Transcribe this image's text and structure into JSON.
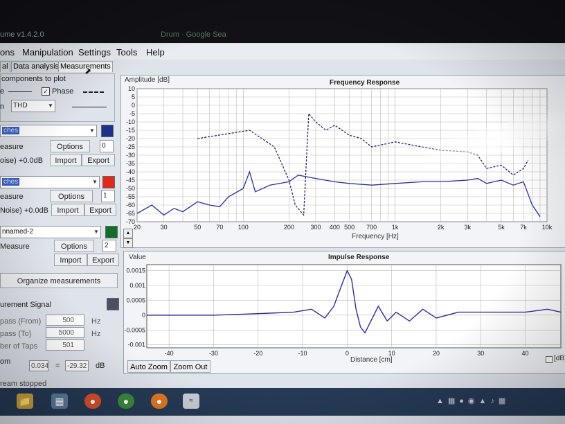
{
  "window": {
    "title": "ume v1.4.2.0",
    "title2": "Drum · Google Sea"
  },
  "menu": [
    "ons",
    "Manipulation",
    "Settings",
    "Tools",
    "Help"
  ],
  "tabs": [
    "al",
    "Data analysis",
    "Measurements"
  ],
  "panel": {
    "components_label": "components to plot",
    "line_label": "e",
    "phase_label": "Phase",
    "thd_prefix": "n",
    "thd_value": "THD",
    "measurements": [
      {
        "name": "ches",
        "color": "#1f2f8c",
        "measure_label": "easure",
        "options_label": "Options",
        "index": "0",
        "noise": "oise) +0.0dB",
        "import_label": "Import",
        "export_label": "Export"
      },
      {
        "name": "ches",
        "color": "#e02a1a",
        "measure_label": "easure",
        "options_label": "Options",
        "index": "1",
        "noise": "Noise) +0.0dB",
        "import_label": "Import",
        "export_label": "Export"
      },
      {
        "name": "nnamed-2",
        "color": "#0f6e2a",
        "measure_label": "Measure",
        "options_label": "Options",
        "index": "2",
        "noise": "",
        "import_label": "Import",
        "export_label": "Export"
      }
    ],
    "organize_label": "Organize measurements",
    "signal_label": "urement Signal",
    "signal_color": "#4a5060",
    "bandpass_from_label": "pass (From)",
    "bandpass_from_value": "500",
    "bandpass_to_label": "pass (To)",
    "bandpass_to_value": "5000",
    "taps_label": "ber of Taps",
    "taps_value": "501",
    "hz": "Hz",
    "zoom_label": "om",
    "zoom_value": "0.034",
    "eq": "=",
    "db_value": "-29.32",
    "db_unit": "dB",
    "status": "ream stopped"
  },
  "freq_chart": {
    "ylabel_top": "Amplitude [dB]",
    "title": "Frequency Response",
    "xlabel": "Frequency [Hz]",
    "yticks": [
      "10",
      "5",
      "0",
      "-5",
      "-10",
      "-15",
      "-20",
      "-25",
      "-30",
      "-35",
      "-40",
      "-45",
      "-50",
      "-55",
      "-60",
      "-65",
      "-70"
    ],
    "xticks": [
      {
        "f": 20,
        "label": "20"
      },
      {
        "f": 30,
        "label": "30"
      },
      {
        "f": 50,
        "label": "50"
      },
      {
        "f": 70,
        "label": "70"
      },
      {
        "f": 100,
        "label": "100"
      },
      {
        "f": 200,
        "label": "200"
      },
      {
        "f": 300,
        "label": "300"
      },
      {
        "f": 400,
        "label": "400"
      },
      {
        "f": 500,
        "label": "500"
      },
      {
        "f": 700,
        "label": "700"
      },
      {
        "f": 1000,
        "label": "1k"
      },
      {
        "f": 2000,
        "label": "2k"
      },
      {
        "f": 3000,
        "label": "3k"
      },
      {
        "f": 5000,
        "label": "5k"
      },
      {
        "f": 7000,
        "label": "7k"
      },
      {
        "f": 10000,
        "label": "10k"
      }
    ]
  },
  "impulse_chart": {
    "ylabel_top": "Value",
    "title": "Impulse Response",
    "xlabel": "Distance [cm]",
    "yticks": [
      "0.0015",
      "0.001",
      "0.0005",
      "0",
      "-0.0005",
      "-0.001"
    ],
    "xticks": [
      "-40",
      "-30",
      "-20",
      "-10",
      "0",
      "10",
      "20",
      "30",
      "40"
    ],
    "auto_zoom": "Auto Zoom",
    "zoom_out": "Zoom Out",
    "db_check": "[dB]"
  },
  "chart_data": [
    {
      "type": "line",
      "title": "Frequency Response",
      "xlabel": "Frequency [Hz]",
      "ylabel": "Amplitude [dB]",
      "xscale": "log",
      "xlim": [
        20,
        10000
      ],
      "ylim": [
        -70,
        10
      ],
      "grid": true,
      "series": [
        {
          "style": "solid",
          "color": "#2a2f9a",
          "x": [
            20,
            25,
            30,
            35,
            40,
            50,
            60,
            70,
            80,
            100,
            110,
            120,
            150,
            200,
            230,
            300,
            400,
            500,
            700,
            1000,
            1500,
            2000,
            3000,
            3500,
            4000,
            5000,
            6000,
            7000,
            8000,
            9000
          ],
          "y": [
            -65,
            -60,
            -66,
            -62,
            -64,
            -58,
            -60,
            -61,
            -55,
            -50,
            -40,
            -52,
            -48,
            -46,
            -42,
            -44,
            -46,
            -47,
            -48,
            -47,
            -46,
            -46,
            -45,
            -44,
            -47,
            -45,
            -48,
            -46,
            -60,
            -67
          ]
        },
        {
          "style": "dashed",
          "color": "#1e2468",
          "x": [
            50,
            110,
            160,
            200,
            220,
            250,
            270,
            300,
            350,
            400,
            500,
            600,
            700,
            1000,
            1500,
            2000,
            3000,
            3500,
            4000,
            5000,
            6000,
            7000,
            7500
          ],
          "y": [
            -20,
            -15,
            -25,
            -45,
            -60,
            -66,
            -5,
            -10,
            -15,
            -12,
            -18,
            -20,
            -25,
            -22,
            -25,
            -27,
            -28,
            -30,
            -38,
            -36,
            -42,
            -38,
            -33
          ]
        }
      ]
    },
    {
      "type": "line",
      "title": "Impulse Response",
      "xlabel": "Distance [cm]",
      "ylabel": "Value",
      "xlim": [
        -45,
        48
      ],
      "ylim": [
        -0.0011,
        0.0017
      ],
      "grid": true,
      "series": [
        {
          "color": "#2a2f9a",
          "x": [
            -45,
            -30,
            -20,
            -12,
            -8,
            -5,
            -3,
            -1,
            0,
            1,
            2,
            3,
            4,
            5,
            7,
            9,
            11,
            14,
            17,
            20,
            25,
            30,
            35,
            40,
            45,
            48
          ],
          "y": [
            0.0,
            0.0,
            5e-05,
            0.0001,
            0.0002,
            -0.0001,
            0.0003,
            0.0011,
            0.0015,
            0.0012,
            0.0002,
            -0.0004,
            -0.0006,
            -0.0003,
            0.0003,
            -0.0002,
            0.0001,
            -0.0002,
            0.0002,
            -0.0001,
            0.0001,
            0.0001,
            0.0001,
            0.0001,
            0.0002,
            0.0001
          ]
        }
      ]
    }
  ],
  "taskbar": {
    "icons": [
      "folder-icon",
      "explorer-icon",
      "chrome-icon",
      "chrome-icon",
      "firefox-icon",
      "app-icon"
    ]
  }
}
